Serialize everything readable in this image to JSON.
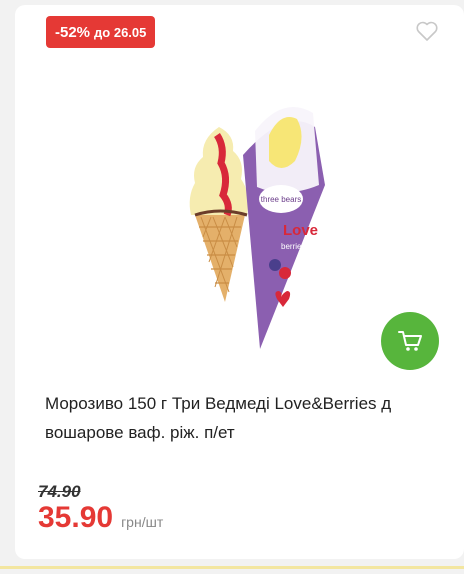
{
  "product": {
    "discount_badge": {
      "percent": "-52%",
      "until": "до 26.05"
    },
    "image_alt": "Three Bears Love&Berries ice cream cone",
    "title": "Морозиво 150 г Три Ведмеді Love&Berries д вошарове ваф. ріж. п/ет",
    "old_price": "74.90",
    "price": "35.90",
    "unit": "грн/шт",
    "image_labels": {
      "brand": "three bears",
      "love": "Love",
      "berries": "berries"
    }
  },
  "colors": {
    "accent_red": "#e53935",
    "cart_green": "#57b53c",
    "heart_outline": "#c8c8c8"
  },
  "icons": {
    "wishlist": "heart-outline-icon",
    "cart": "shopping-cart-icon"
  }
}
